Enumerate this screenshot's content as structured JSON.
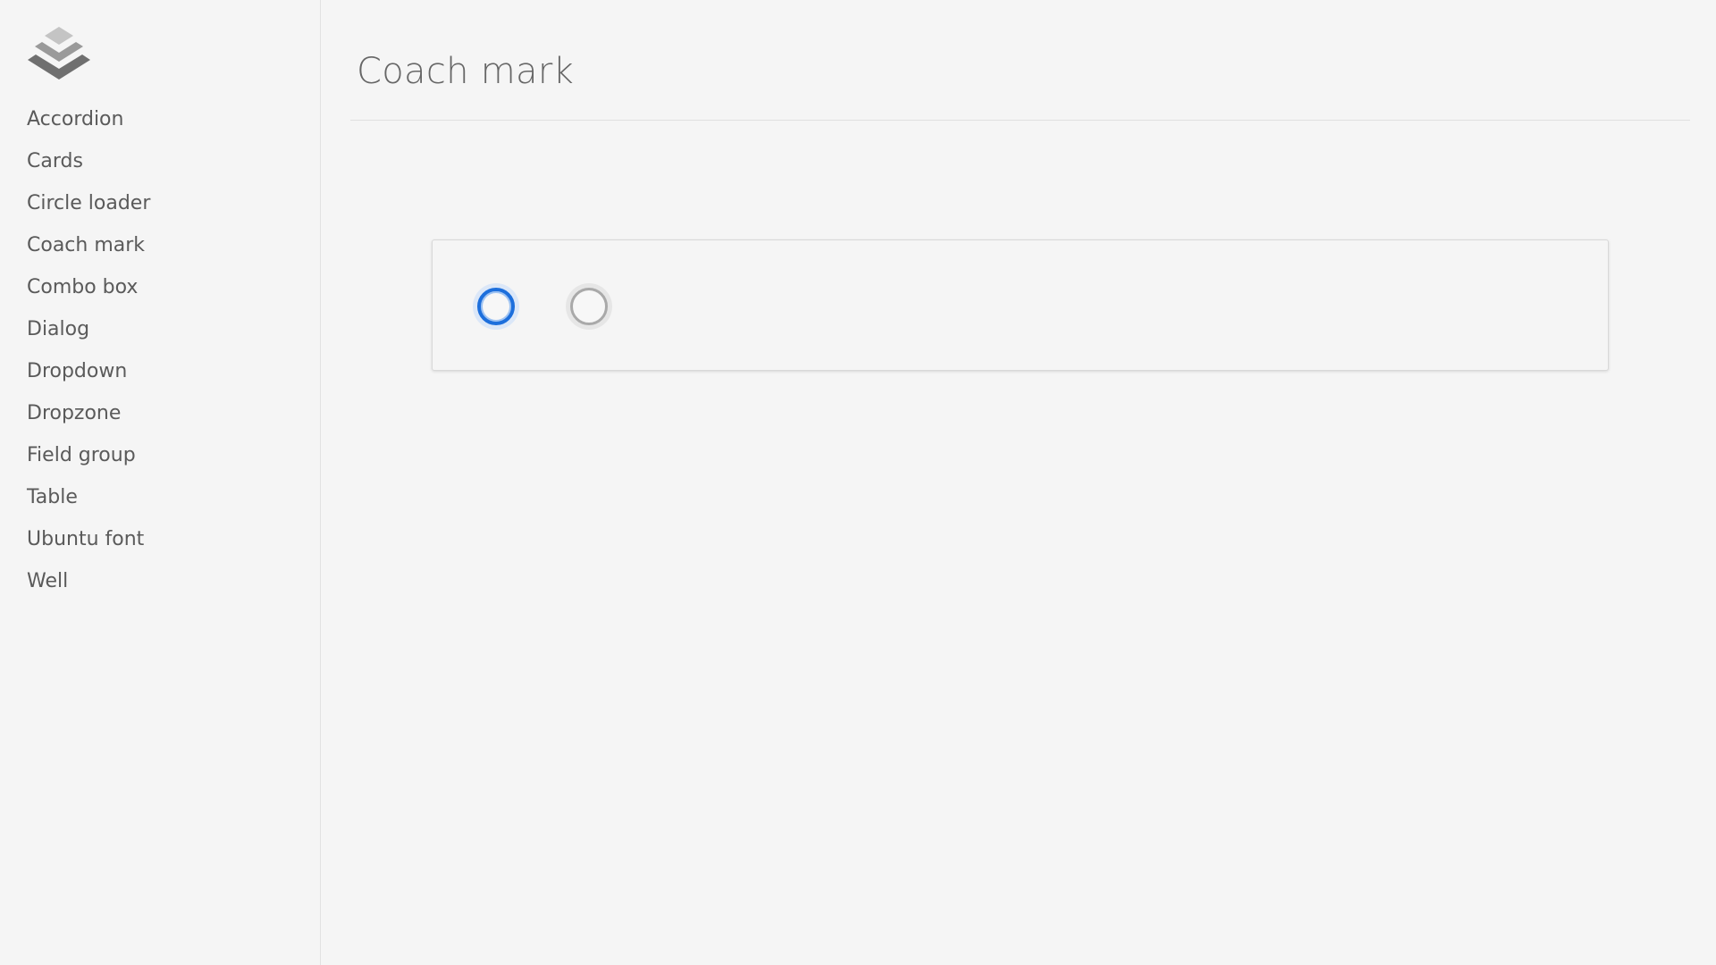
{
  "sidebar": {
    "logo_icon": "stacked-layers-icon",
    "items": [
      {
        "label": "Accordion"
      },
      {
        "label": "Cards"
      },
      {
        "label": "Circle loader"
      },
      {
        "label": "Coach mark"
      },
      {
        "label": "Combo box"
      },
      {
        "label": "Dialog"
      },
      {
        "label": "Dropdown"
      },
      {
        "label": "Dropzone"
      },
      {
        "label": "Field group"
      },
      {
        "label": "Table"
      },
      {
        "label": "Ubuntu font"
      },
      {
        "label": "Well"
      }
    ]
  },
  "main": {
    "title": "Coach mark",
    "demo": {
      "marks": [
        {
          "state": "active",
          "color": "#1d6fdc"
        },
        {
          "state": "inactive",
          "color": "#a9a9a9"
        }
      ]
    }
  },
  "colors": {
    "background": "#f5f5f5",
    "accent": "#1d6fdc",
    "text": "#555555"
  }
}
